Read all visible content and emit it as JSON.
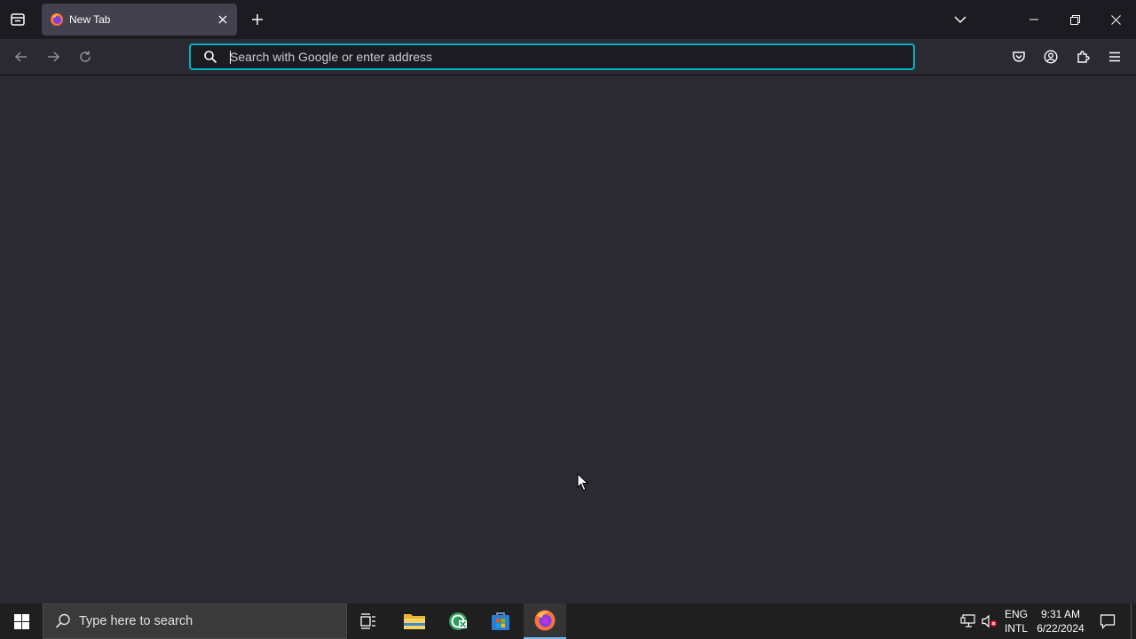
{
  "browser": {
    "tab": {
      "title": "New Tab"
    },
    "urlbar": {
      "placeholder": "Search with Google or enter address",
      "value": ""
    }
  },
  "taskbar": {
    "search_placeholder": "Type here to search",
    "language": {
      "line1": "ENG",
      "line2": "INTL"
    },
    "clock": {
      "time": "9:31 AM",
      "date": "6/22/2024"
    },
    "accent": "#76b9ed"
  },
  "colors": {
    "tabstrip_bg": "#1c1b22",
    "toolbar_bg": "#2b2a33",
    "urlbar_focus": "#00b3c6",
    "taskbar_bg": "#1f1f1f"
  }
}
